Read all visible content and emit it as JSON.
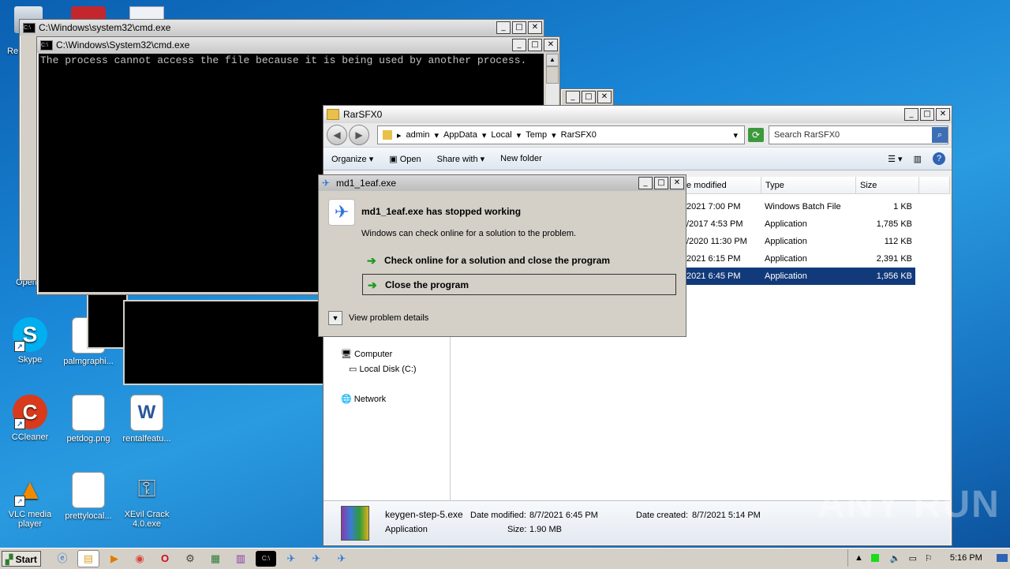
{
  "desktop": {
    "icons": [
      {
        "name": "skype",
        "label": "Skype",
        "color": "#00aff0",
        "glyph": "S"
      },
      {
        "name": "palmgraphics",
        "label": "palmgraphi...",
        "color": "#ffffff",
        "glyph": ""
      },
      {
        "name": "ccleaner",
        "label": "CCleaner",
        "color": "#d93a1b",
        "glyph": "C"
      },
      {
        "name": "petdog",
        "label": "petdog.png",
        "color": "#ffffff",
        "glyph": ""
      },
      {
        "name": "rentalfeature",
        "label": "rentalfeatu...",
        "color": "#2b579a",
        "glyph": "W"
      },
      {
        "name": "vlc",
        "label": "VLC media player",
        "color": "#f08a00",
        "glyph": "▲"
      },
      {
        "name": "prettylocal",
        "label": "prettylocal...",
        "color": "#ffffff",
        "glyph": ""
      },
      {
        "name": "xevil",
        "label": "XEvil Crack 4.0.exe",
        "color": "#c0c0c0",
        "glyph": "🔑"
      }
    ],
    "partial_labels": [
      "Re",
      "Open"
    ]
  },
  "cmd_back": {
    "title": "C:\\Windows\\system32\\cmd.exe"
  },
  "cmd_front": {
    "title": "C:\\Windows\\System32\\cmd.exe",
    "output": "The process cannot access the file because it is being used by another process."
  },
  "explorer": {
    "title": "RarSFX0",
    "breadcrumb": [
      "admin",
      "AppData",
      "Local",
      "Temp",
      "RarSFX0"
    ],
    "search_placeholder": "Search RarSFX0",
    "toolbar": {
      "organize": "Organize",
      "open": "Open",
      "share_with": "Share with",
      "new_folder": "New folder"
    },
    "columns": {
      "date_modified": "e modified",
      "type": "Type",
      "size": "Size"
    },
    "rows": [
      {
        "date": "2021 7:00 PM",
        "type": "Windows Batch File",
        "size": "1 KB"
      },
      {
        "date": "/2017 4:53 PM",
        "type": "Application",
        "size": "1,785 KB"
      },
      {
        "date": "/2020 11:30 PM",
        "type": "Application",
        "size": "112 KB"
      },
      {
        "date": "2021 6:15 PM",
        "type": "Application",
        "size": "2,391 KB"
      },
      {
        "date": "2021 6:45 PM",
        "type": "Application",
        "size": "1,956 KB"
      }
    ],
    "nav": {
      "computer": "Computer",
      "local_disk": "Local Disk (C:)",
      "network": "Network"
    },
    "details": {
      "filename": "keygen-step-5.exe",
      "filetype": "Application",
      "date_modified_label": "Date modified:",
      "date_modified": "8/7/2021 6:45 PM",
      "date_created_label": "Date created:",
      "date_created": "8/7/2021 5:14 PM",
      "size_label": "Size:",
      "size": "1.90 MB"
    }
  },
  "dialog": {
    "title": "md1_1eaf.exe",
    "heading": "md1_1eaf.exe has stopped working",
    "message": "Windows can check online for a solution to the problem.",
    "option1": "Check online for a solution and close the program",
    "option2": "Close the program",
    "details": "View problem details"
  },
  "taskbar": {
    "start": "Start",
    "clock": "5:16 PM"
  },
  "watermark": "ANY RUN"
}
